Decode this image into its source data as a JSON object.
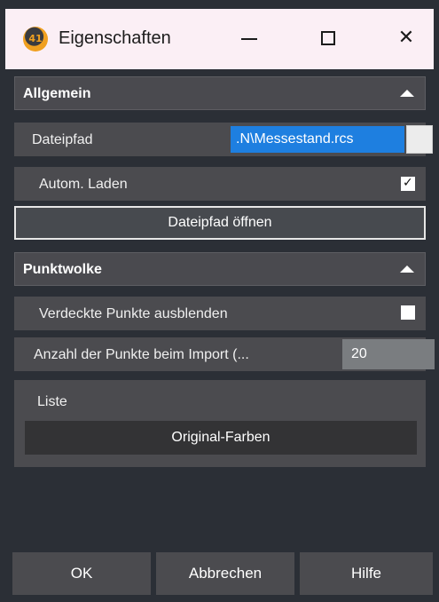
{
  "window": {
    "title": "Eigenschaften",
    "icon_text": "41",
    "controls": {
      "minimize": "minimize-icon",
      "maximize": "maximize-icon",
      "close": "close-icon"
    }
  },
  "sections": {
    "general": {
      "title": "Allgemein",
      "filepath_label": "Dateipfad",
      "filepath_value": ".N\\Messestand.rcs",
      "autoload_label": "Autom. Laden",
      "autoload_checked": true,
      "open_button": "Dateipfad öffnen"
    },
    "pointcloud": {
      "title": "Punktwolke",
      "hide_label": "Verdeckte Punkte ausblenden",
      "hide_checked": false,
      "count_label": "Anzahl der Punkte beim Import (...",
      "count_value": "20",
      "list_label": "Liste",
      "list_item": "Original-Farben"
    }
  },
  "footer": {
    "ok": "OK",
    "cancel": "Abbrechen",
    "help": "Hilfe"
  },
  "colors": {
    "accent_selection": "#1e7fe0",
    "background": "#2b2f36",
    "titlebar": "#fbeff5"
  }
}
